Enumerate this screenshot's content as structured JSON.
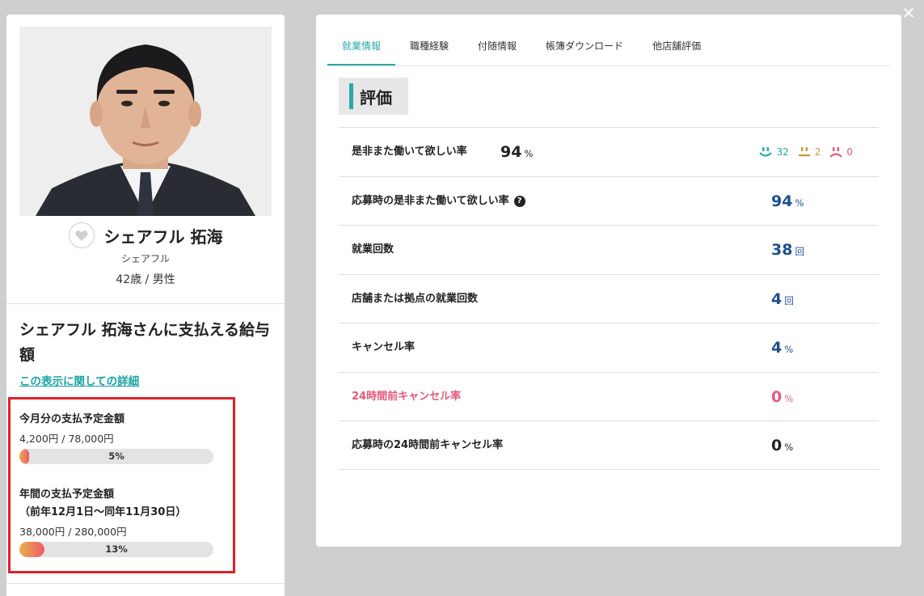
{
  "close_label": "✕",
  "profile": {
    "name": "シェアフル 拓海",
    "kana": "シェアフル",
    "age_sex": "42歳 / 男性"
  },
  "pay": {
    "title": "シェアフル 拓海さんに支払える給与額",
    "detail_link": "この表示に関しての詳細",
    "monthly": {
      "label": "今月分の支払予定金額",
      "amount": "4,200円 / 78,000円",
      "percent_label": "5%",
      "percent": 5
    },
    "yearly": {
      "label_line1": "年間の支払予定金額",
      "label_line2": "（前年12月1日〜同年11月30日）",
      "amount": "38,000円 / 280,000円",
      "percent_label": "13%",
      "percent": 13
    }
  },
  "tabs": [
    {
      "label": "就業情報",
      "active": true
    },
    {
      "label": "職種経験",
      "active": false
    },
    {
      "label": "付随情報",
      "active": false
    },
    {
      "label": "帳簿ダウンロード",
      "active": false
    },
    {
      "label": "他店舗評価",
      "active": false
    }
  ],
  "evaluation": {
    "heading": "評価",
    "rows": [
      {
        "label": "是非また働いて欲しい率",
        "value": "94",
        "unit": "%",
        "faces": {
          "good": "32",
          "neutral": "2",
          "bad": "0"
        }
      },
      {
        "label": "応募時の是非また働いて欲しい率",
        "help": "?",
        "value": "94",
        "unit": "%"
      },
      {
        "label": "就業回数",
        "value": "38",
        "unit": "回"
      },
      {
        "label": "店舗または拠点の就業回数",
        "value": "4",
        "unit": "回"
      },
      {
        "label": "キャンセル率",
        "value": "4",
        "unit": "%"
      },
      {
        "label": "24時間前キャンセル率",
        "value": "0",
        "unit": "%"
      },
      {
        "label": "応募時の24時間前キャンセル率",
        "value": "0",
        "unit": "%"
      }
    ]
  },
  "colors": {
    "accent_teal": "#2aa9a9",
    "value_blue": "#1d4f91",
    "alert_red": "#e65a79",
    "highlight_red": "#e0202a",
    "face_good": "#2aa9a9",
    "face_neutral": "#c99a2e",
    "face_bad": "#e65a79"
  }
}
